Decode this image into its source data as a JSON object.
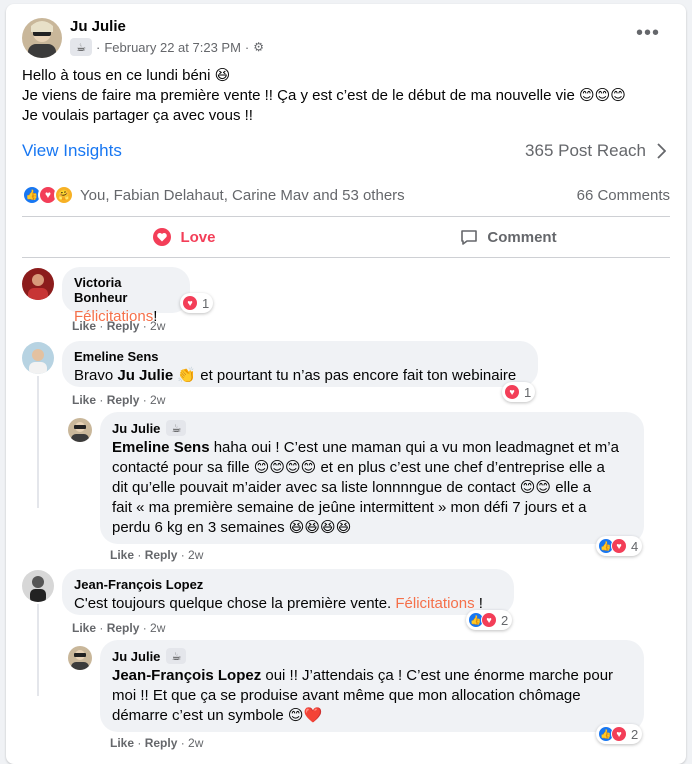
{
  "post": {
    "author": "Ju Julie",
    "badge_icon": "coffee-cup-icon",
    "timestamp": "February 22 at 7:23 PM",
    "audience_sep": "·",
    "text_lines": [
      "Hello à tous en ce lundi béni 😆",
      "Je viens de faire ma première vente !! Ça y est c’est de le début de ma nouvelle vie 😊😊😊",
      "Je voulais partager ça avec vous !!"
    ],
    "view_insights": "View Insights",
    "post_reach": "365 Post Reach",
    "reactions_text": "You, Fabian Delahaut, Carine Mav and 53 others",
    "comments_count": "66 Comments",
    "love_label": "Love",
    "comment_label": "Comment"
  },
  "comments": [
    {
      "name": "Victoria Bonheur",
      "text_highlight": "Félicitations",
      "text_after": "!",
      "reaction_count": "1",
      "like": "Like",
      "reply": "Reply",
      "time": "2w"
    },
    {
      "name": "Emeline Sens",
      "text_before": "Bravo ",
      "mention": "Ju Julie",
      "text_after": " 👏 et pourtant tu n’as pas encore fait ton webinaire",
      "reaction_count": "1",
      "like": "Like",
      "reply": "Reply",
      "time": "2w",
      "reply_item": {
        "name": "Ju Julie",
        "mention": "Emeline Sens",
        "lines": [
          " haha oui ! C’est une maman qui a vu mon leadmagnet et m’a",
          "contacté pour sa fille 😊😊😊😊 et en plus c’est une chef d’entreprise elle a",
          "dit qu’elle pouvait m’aider avec sa liste lonnnngue de contact 😊😊 elle a",
          "fait « ma première semaine de jeûne intermittent » mon défi 7 jours et a",
          "perdu 6 kg en 3 semaines 😆😆😆😆"
        ],
        "reaction_count": "4",
        "like": "Like",
        "reply": "Reply",
        "time": "2w"
      }
    },
    {
      "name": "Jean-François Lopez",
      "text_before": "C'est toujours quelque chose la première vente. ",
      "text_highlight": "Félicitations",
      "text_after": " !",
      "reaction_count": "2",
      "like": "Like",
      "reply": "Reply",
      "time": "2w",
      "reply_item": {
        "name": "Ju Julie",
        "mention": "Jean-François Lopez",
        "lines": [
          " oui !! J’attendais ça ! C’est une énorme marche pour",
          "moi !! Et que ça se produise avant même que mon allocation chômage",
          "démarre c’est un symbole 😊❤️"
        ],
        "reaction_count": "2",
        "like": "Like",
        "reply": "Reply",
        "time": "2w"
      }
    }
  ],
  "colors": {
    "accent": "#1877f2",
    "love": "#f33e58",
    "highlight": "#f5704a"
  }
}
